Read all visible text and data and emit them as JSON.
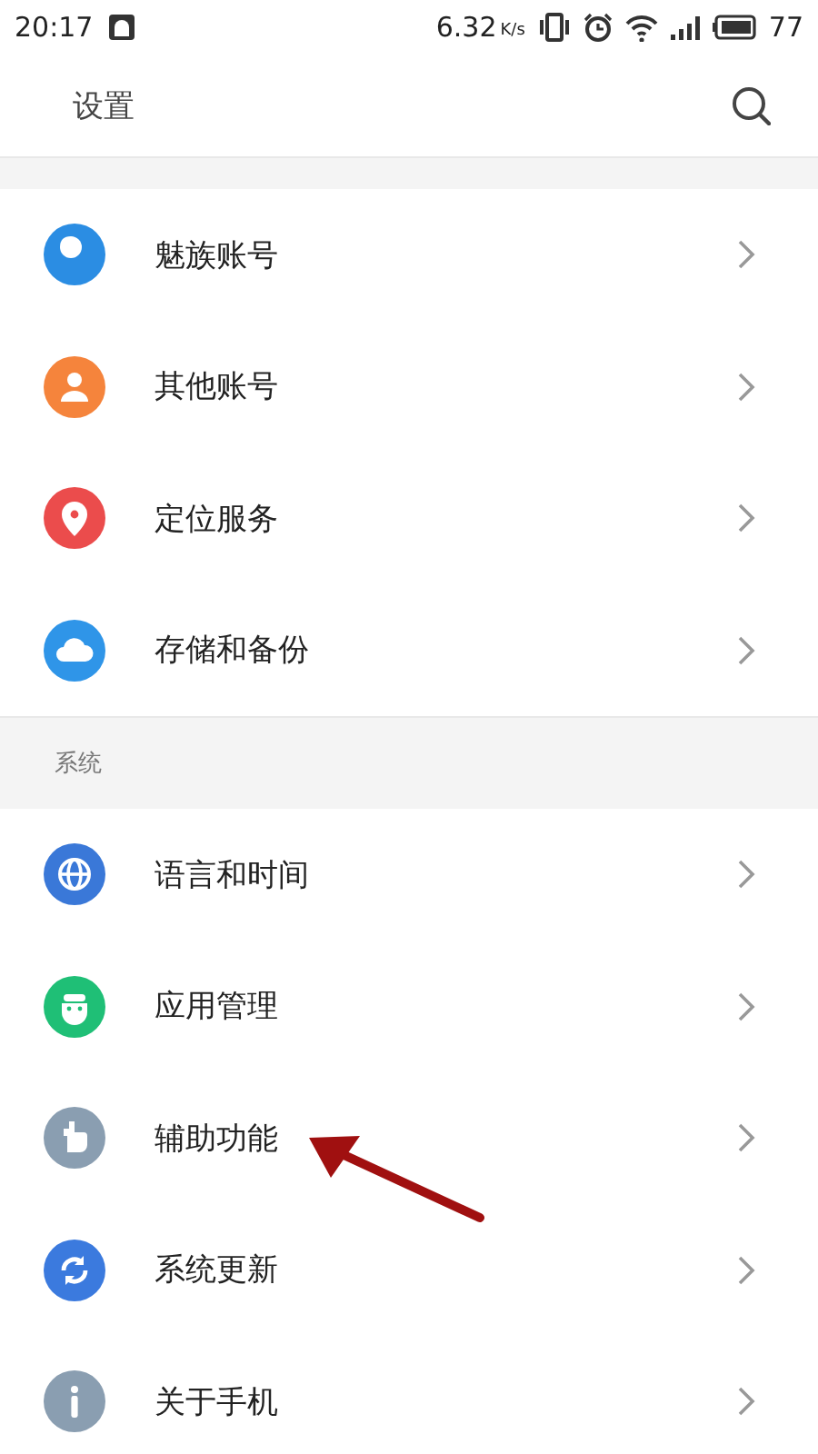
{
  "status_bar": {
    "time": "20:17",
    "speed": "6.32",
    "speed_unit": "K/s",
    "battery": "77"
  },
  "header": {
    "title": "设置"
  },
  "sections": [
    {
      "items": [
        {
          "label": "魅族账号",
          "color": "#2b8de3"
        },
        {
          "label": "其他账号",
          "color": "#f5843c"
        },
        {
          "label": "定位服务",
          "color": "#eb4c4c"
        },
        {
          "label": "存储和备份",
          "color": "#2f95e8"
        }
      ]
    },
    {
      "title": "系统",
      "items": [
        {
          "label": "语言和时间",
          "color": "#3a78d8"
        },
        {
          "label": "应用管理",
          "color": "#1fbf76"
        },
        {
          "label": "辅助功能",
          "color": "#8a9eb1"
        },
        {
          "label": "系统更新",
          "color": "#3b7ade"
        },
        {
          "label": "关于手机",
          "color": "#8a9eb1"
        }
      ]
    }
  ],
  "annotation": {
    "kind": "arrow"
  }
}
